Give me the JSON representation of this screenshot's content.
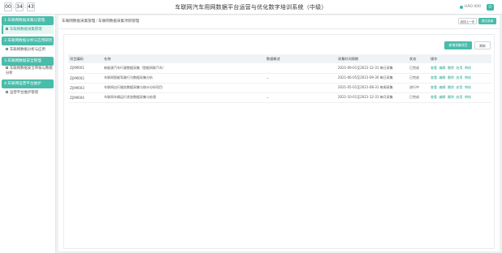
{
  "timer": {
    "hours": "00",
    "minutes": "34",
    "seconds": "43"
  },
  "header": {
    "title": "车联网汽车用网数据平台运营与优化数字培训系统（中级）",
    "user": "HAO 000",
    "logout_icon": "logout-icon"
  },
  "sidebar": {
    "sections": [
      {
        "title": "1.车联网数据采集与管理",
        "items": [
          {
            "label": "车联网数据采集管理",
            "active": true
          }
        ]
      },
      {
        "title": "2.车联网数据分析与应用研究",
        "items": [
          {
            "label": "车联网数据分析与应用",
            "active": false
          }
        ]
      },
      {
        "title": "3.车联网数据安全管理",
        "items": [
          {
            "label": "车联网数据安全审核与数据分析",
            "active": false
          }
        ]
      },
      {
        "title": "4.车联网运营平台维护",
        "items": [
          {
            "label": "运营平台维护管理",
            "active": false
          }
        ]
      }
    ]
  },
  "breadcrumb": {
    "parent": "车联网数据采集管理",
    "current": "车联网数据采集项目管理"
  },
  "header_buttons": {
    "reset": "返回上一步",
    "submit": "提交答案"
  },
  "panel": {
    "add_button": "新增采集项目",
    "refresh_button": "刷新"
  },
  "table": {
    "columns": [
      "项目编码",
      "名称",
      "数据概述",
      "采集时间周期",
      "状态",
      "操作"
    ],
    "rows": [
      {
        "code": "ZJXM001",
        "name": "新能源汽车行驶数据采集（智能网联汽车）",
        "desc": "",
        "period": "2021-09-01至2021-12-31 每日采集",
        "status": "已完成"
      },
      {
        "code": "ZJXM002",
        "name": "车联网智能驾驶行为数据采集分析",
        "desc": "--",
        "period": "2021-06-05至2021-09-30 每日采集",
        "status": "已完成"
      },
      {
        "code": "ZJXM003",
        "name": "车联网出行服务数据采集与统计分析项目",
        "desc": "",
        "period": "2021-05-01至2021-08-31 每周采集",
        "status": "进行中"
      },
      {
        "code": "ZJXM004",
        "name": "车联网车辆运行状态数据采集与处理",
        "desc": "--",
        "period": "2021-10-01至2021-12-31 每月采集",
        "status": "已完成"
      }
    ],
    "actions": [
      "查看",
      "编辑",
      "删除",
      "启用",
      "审核"
    ]
  }
}
